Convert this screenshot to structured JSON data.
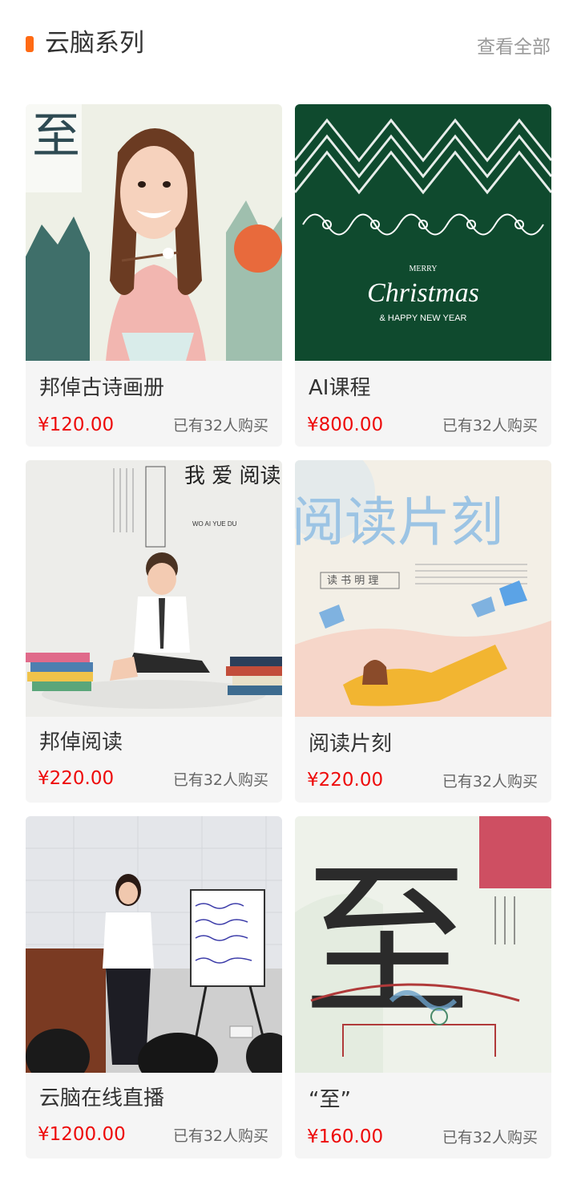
{
  "header": {
    "title": "云脑系列",
    "view_all": "查看全部",
    "accent_color": "#ff6a13"
  },
  "products": [
    {
      "name": "邦倬古诗画册",
      "price": "¥120.00",
      "sold": "已有32人购买",
      "image": "illustrated-girl-eating-tangyuan"
    },
    {
      "name": "AI课程",
      "price": "¥800.00",
      "sold": "已有32人购买",
      "image": "merry-christmas-card",
      "image_text": {
        "line1": "MERRY",
        "line2": "Christmas",
        "line3": "& HAPPY NEW YEAR"
      }
    },
    {
      "name": "邦倬阅读",
      "price": "¥220.00",
      "sold": "已有32人购买",
      "image": "boy-reading-poster",
      "image_text": {
        "title": "我 爱 阅读",
        "pinyin": "WO AI YUE DU",
        "vertical": "知识改变命运"
      }
    },
    {
      "name": "阅读片刻",
      "price": "¥220.00",
      "sold": "已有32人购买",
      "image": "reading-moment-poster",
      "image_text": {
        "title": "阅读片刻",
        "seal": "读 书 明 理"
      }
    },
    {
      "name": "云脑在线直播",
      "price": "¥1200.00",
      "sold": "已有32人购买",
      "image": "live-lecture-photo"
    },
    {
      "name": "“至”",
      "price": "¥160.00",
      "sold": "已有32人购买",
      "image": "calligraphy-zhi-poster"
    }
  ],
  "colors": {
    "price": "#ee0a0a",
    "card_bg": "#f5f5f5",
    "christmas_green": "#0f4a2e"
  }
}
